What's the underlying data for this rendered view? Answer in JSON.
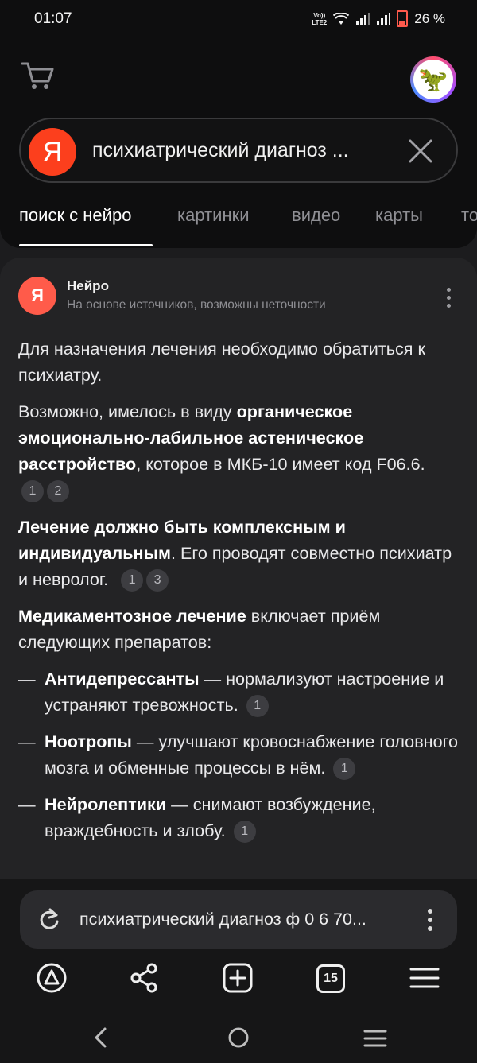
{
  "status": {
    "time": "01:07",
    "volte_top": "Vo))",
    "volte_bottom": "LTE2",
    "battery": "26 %"
  },
  "search": {
    "logo": "Я",
    "query": "психиатрический диагноз ..."
  },
  "tabs": [
    "поиск с нейро",
    "картинки",
    "видео",
    "карты",
    "то"
  ],
  "neuro": {
    "logo": "Я",
    "name": "Нейро",
    "subtitle": "На основе источников, возможны неточности",
    "p1": "Для назначения лечения необходимо обратиться к психиатру.",
    "p2_a": "Возможно, имелось в виду ",
    "p2_b": "органическое эмоционально-лабильное астеническое расстройство",
    "p2_c": ", которое в МКБ-10 имеет код F06.6.",
    "p2_refs": [
      "1",
      "2"
    ],
    "p3_a": "Лечение должно быть комплексным и индивидуальным",
    "p3_b": ". Его проводят совместно психиатр и невролог.",
    "p3_refs": [
      "1",
      "3"
    ],
    "p4_a": "Медикаментозное лечение",
    "p4_b": " включает приём следующих препаратов:",
    "list": [
      {
        "dash": "—",
        "term": "Антидепрессанты",
        "text": " — нормализуют настроение и устраняют тревожность.",
        "ref": "1"
      },
      {
        "dash": "—",
        "term": "Ноотропы",
        "text": " — улучшают кровоснабжение головного мозга и обменные процессы в нём.",
        "ref": "1"
      },
      {
        "dash": "—",
        "term": "Нейролептики",
        "text": " — снимают возбуждение, враждебность и злобу.",
        "ref": "1"
      }
    ]
  },
  "urlbar": {
    "text": "психиатрический диагноз ф 0 6 70..."
  },
  "nav": {
    "tab_count": "15"
  },
  "colors": {
    "yandex_red": "#fc3f1d",
    "neuro_red": "#ff5b4a",
    "background": "#1c1c1e"
  }
}
